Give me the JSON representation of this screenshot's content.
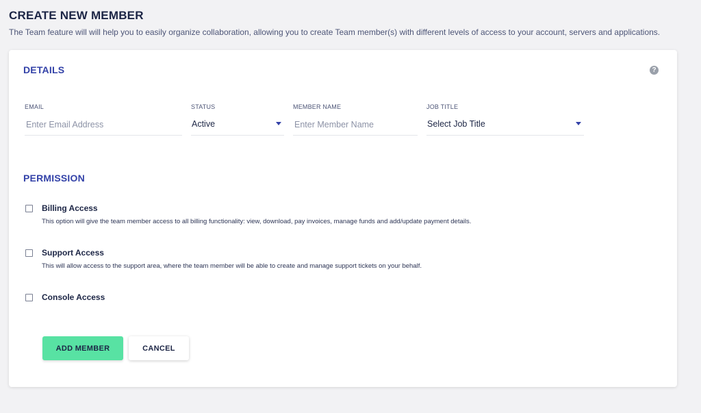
{
  "header": {
    "title": "CREATE NEW MEMBER",
    "description": "The Team feature will will help you to easily organize collaboration, allowing you to create Team member(s) with different levels of access to your account, servers and applications."
  },
  "details": {
    "title": "DETAILS",
    "help_icon": "question-circle-icon",
    "email": {
      "label": "EMAIL",
      "placeholder": "Enter Email Address",
      "value": ""
    },
    "status": {
      "label": "STATUS",
      "value": "Active"
    },
    "member_name": {
      "label": "MEMBER NAME",
      "placeholder": "Enter Member Name",
      "value": ""
    },
    "job_title": {
      "label": "JOB TITLE",
      "value": "Select Job Title"
    }
  },
  "permission": {
    "title": "PERMISSION",
    "items": [
      {
        "label": "Billing Access",
        "description": "This option will give the team member access to all billing functionality: view, download, pay invoices, manage funds and add/update payment details.",
        "checked": false
      },
      {
        "label": "Support Access",
        "description": "This will allow access to the support area, where the team member will be able to create and manage support tickets on your behalf.",
        "checked": false
      },
      {
        "label": "Console Access",
        "description": "",
        "checked": false
      }
    ]
  },
  "actions": {
    "add_label": "ADD MEMBER",
    "cancel_label": "CANCEL"
  },
  "colors": {
    "accent": "#3342a8",
    "primary_button": "#58e2a3",
    "text_dark": "#1c2545",
    "background": "#f2f2f4"
  }
}
